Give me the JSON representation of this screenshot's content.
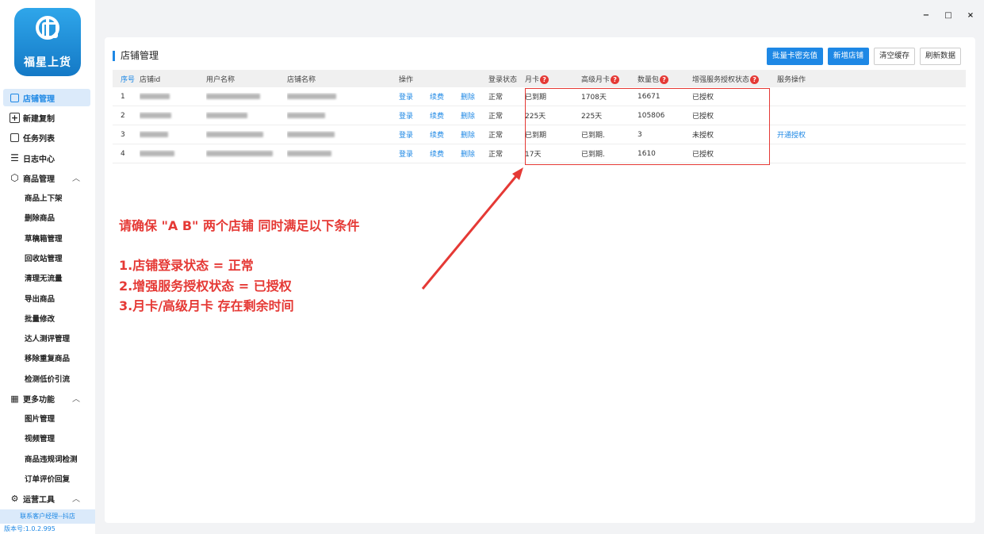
{
  "logo": {
    "text": "福星上货"
  },
  "window": {
    "minimize": "−",
    "maximize": "□",
    "close": "×"
  },
  "sidebar": {
    "items": [
      {
        "label": "店铺管理"
      },
      {
        "label": "新建复制"
      },
      {
        "label": "任务列表"
      },
      {
        "label": "日志中心"
      },
      {
        "label": "商品管理"
      },
      {
        "label": "商品上下架"
      },
      {
        "label": "删除商品"
      },
      {
        "label": "草稿箱管理"
      },
      {
        "label": "回收站管理"
      },
      {
        "label": "清理无流量"
      },
      {
        "label": "导出商品"
      },
      {
        "label": "批量修改"
      },
      {
        "label": "达人测评管理"
      },
      {
        "label": "移除重复商品"
      },
      {
        "label": "检测低价引流"
      },
      {
        "label": "更多功能"
      },
      {
        "label": "图片管理"
      },
      {
        "label": "视频管理"
      },
      {
        "label": "商品违规词检测"
      },
      {
        "label": "订单评价回复"
      },
      {
        "label": "运营工具"
      }
    ],
    "contact": "联系客户经理--抖店",
    "version": "版本号:1.0.2.995"
  },
  "panel": {
    "title": "店铺管理",
    "buttons": {
      "batch_card": "批量卡密充值",
      "new_shop": "新增店铺",
      "clear_cache": "清空缓存",
      "refresh": "刷新数据"
    }
  },
  "table": {
    "headers": [
      "序号",
      "店铺id",
      "用户名称",
      "店铺名称",
      "操作",
      "",
      "",
      "登录状态",
      "月卡",
      "高级月卡",
      "数量包",
      "增强服务授权状态",
      "服务操作"
    ],
    "help_glyph": "?",
    "actions": {
      "login": "登录",
      "renew": "续费",
      "delete": "删除"
    },
    "rows": [
      {
        "idx": "1",
        "status": "正常",
        "monthly": "已到期",
        "advanced": "1708天",
        "quota": "16671",
        "auth": "已授权",
        "service": ""
      },
      {
        "idx": "2",
        "status": "正常",
        "monthly": "225天",
        "advanced": "225天",
        "quota": "105806",
        "auth": "已授权",
        "service": ""
      },
      {
        "idx": "3",
        "status": "正常",
        "monthly": "已到期",
        "advanced": "已到期.",
        "quota": "3",
        "auth": "未授权",
        "service": "开通授权"
      },
      {
        "idx": "4",
        "status": "正常",
        "monthly": "17天",
        "advanced": "已到期.",
        "quota": "1610",
        "auth": "已授权",
        "service": ""
      }
    ]
  },
  "annotation": {
    "headline": "请确保 \"A B\" 两个店铺  同时满足以下条件",
    "items": [
      "1.店铺登录状态 = 正常",
      "2.增强服务授权状态 = 已授权",
      "3.月卡/高级月卡 存在剩余时间"
    ],
    "color": "#e53935"
  },
  "colors": {
    "accent": "#1e88e5",
    "annotation_red": "#e53935"
  }
}
